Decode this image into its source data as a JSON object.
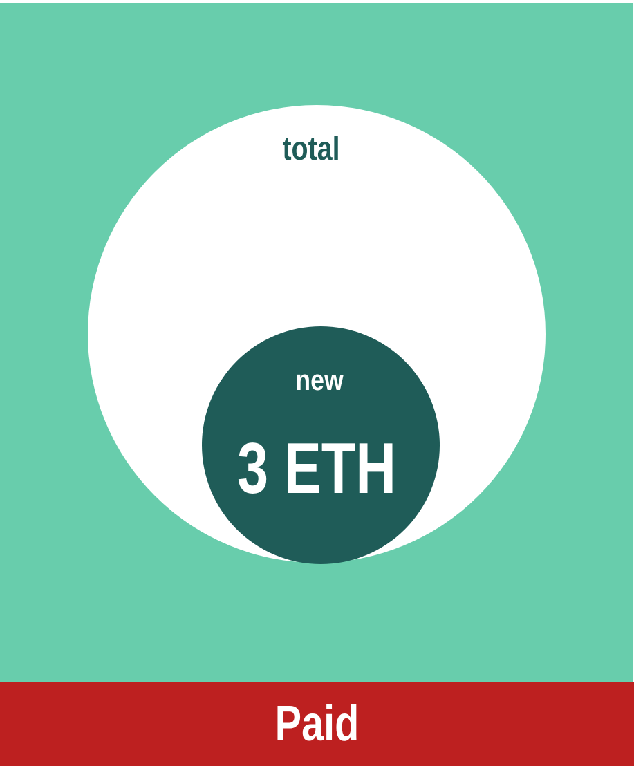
{
  "colors": {
    "panel_background": "#68cdac",
    "outer_circle": "#ffffff",
    "inner_circle": "#1f5c58",
    "status_bar": "#bd2020"
  },
  "outer_circle": {
    "label": "total"
  },
  "inner_circle": {
    "label": "new",
    "amount": "3 ETH"
  },
  "status": {
    "label": "Paid"
  }
}
